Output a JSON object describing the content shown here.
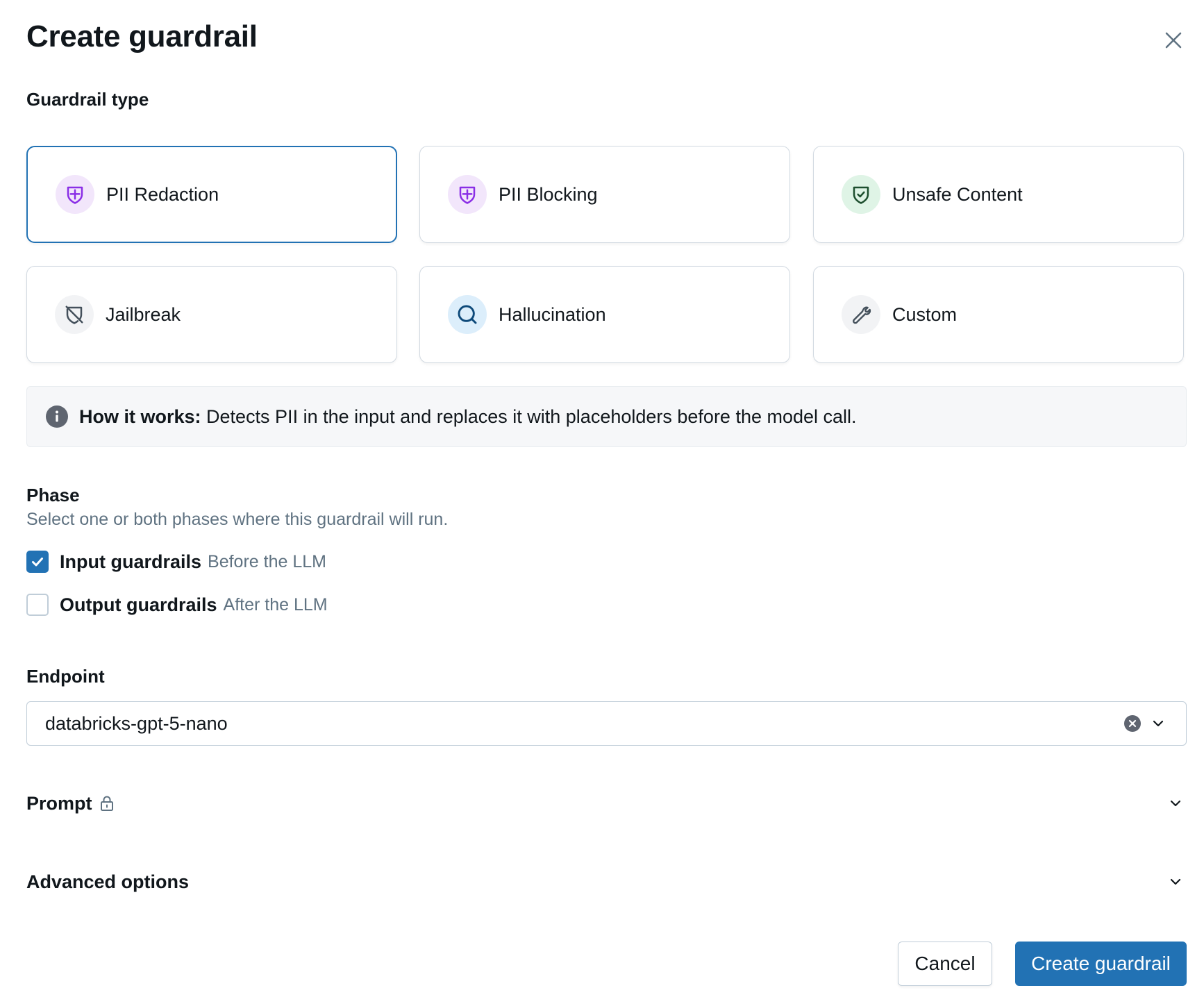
{
  "dialog": {
    "title": "Create guardrail",
    "close_icon": "close-icon"
  },
  "guardrail_type": {
    "label": "Guardrail type",
    "selected": "PII Redaction",
    "options": [
      {
        "label": "PII Redaction",
        "icon": "shield-plus-icon",
        "icon_bg": "#f2e6fb",
        "icon_color": "#8a2ee6"
      },
      {
        "label": "PII Blocking",
        "icon": "shield-plus-icon",
        "icon_bg": "#f2e6fb",
        "icon_color": "#8a2ee6"
      },
      {
        "label": "Unsafe Content",
        "icon": "shield-check-icon",
        "icon_bg": "#dff4e6",
        "icon_color": "#1d7a3e"
      },
      {
        "label": "Jailbreak",
        "icon": "shield-off-icon",
        "icon_bg": "#f2f3f5",
        "icon_color": "#5f7281"
      },
      {
        "label": "Hallucination",
        "icon": "search-icon",
        "icon_bg": "#dceefb",
        "icon_color": "#0e5a93"
      },
      {
        "label": "Custom",
        "icon": "wrench-icon",
        "icon_bg": "#f2f3f5",
        "icon_color": "#5f7281"
      }
    ]
  },
  "info": {
    "icon": "info-icon",
    "bold": "How it works:",
    "text": " Detects PII in the input and replaces it with placeholders before the model call."
  },
  "phase": {
    "label": "Phase",
    "hint": "Select one or both phases where this guardrail will run.",
    "options": [
      {
        "label": "Input guardrails",
        "sub": "Before the LLM",
        "checked": true
      },
      {
        "label": "Output guardrails",
        "sub": "After the LLM",
        "checked": false
      }
    ]
  },
  "endpoint": {
    "label": "Endpoint",
    "value": "databricks-gpt-5-nano",
    "clear_icon": "clear-icon",
    "chevron_icon": "chevron-down-icon"
  },
  "prompt": {
    "label": "Prompt",
    "lock_icon": "lock-icon",
    "chevron_icon": "chevron-down-icon"
  },
  "advanced": {
    "label": "Advanced options",
    "chevron_icon": "chevron-down-icon"
  },
  "footer": {
    "cancel_label": "Cancel",
    "submit_label": "Create guardrail"
  },
  "colors": {
    "primary": "#2272b4",
    "text": "#11171c",
    "secondary_text": "#5f7281",
    "border": "#d1d9e1"
  }
}
